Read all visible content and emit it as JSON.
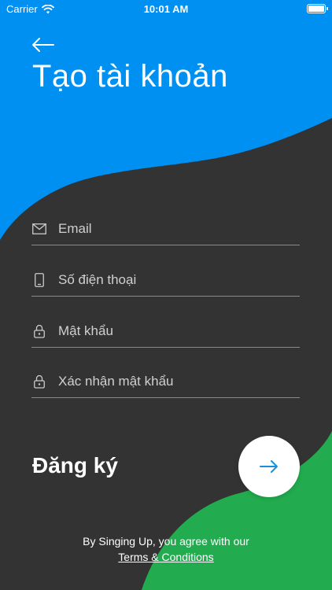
{
  "status_bar": {
    "carrier": "Carrier",
    "time": "10:01 AM",
    "battery_level": 1.0
  },
  "colors": {
    "blue": "#0090F2",
    "dark": "#333333",
    "green": "#22AC4F",
    "white": "#FFFFFF"
  },
  "header": {
    "back_icon": "arrow-left-icon",
    "title": "Tạo tài khoản"
  },
  "form": {
    "fields": [
      {
        "icon": "envelope-icon",
        "placeholder": "Email",
        "value": ""
      },
      {
        "icon": "phone-icon",
        "placeholder": "Số điện thoại",
        "value": ""
      },
      {
        "icon": "lock-icon",
        "placeholder": "Mật khẩu",
        "value": ""
      },
      {
        "icon": "lock-icon",
        "placeholder": "Xác nhận mật khẩu",
        "value": ""
      }
    ]
  },
  "register": {
    "label": "Đăng ký",
    "submit_icon": "arrow-right-icon"
  },
  "footer": {
    "text": "By Singing Up, you agree with our",
    "link": "Terms & Conditions"
  }
}
